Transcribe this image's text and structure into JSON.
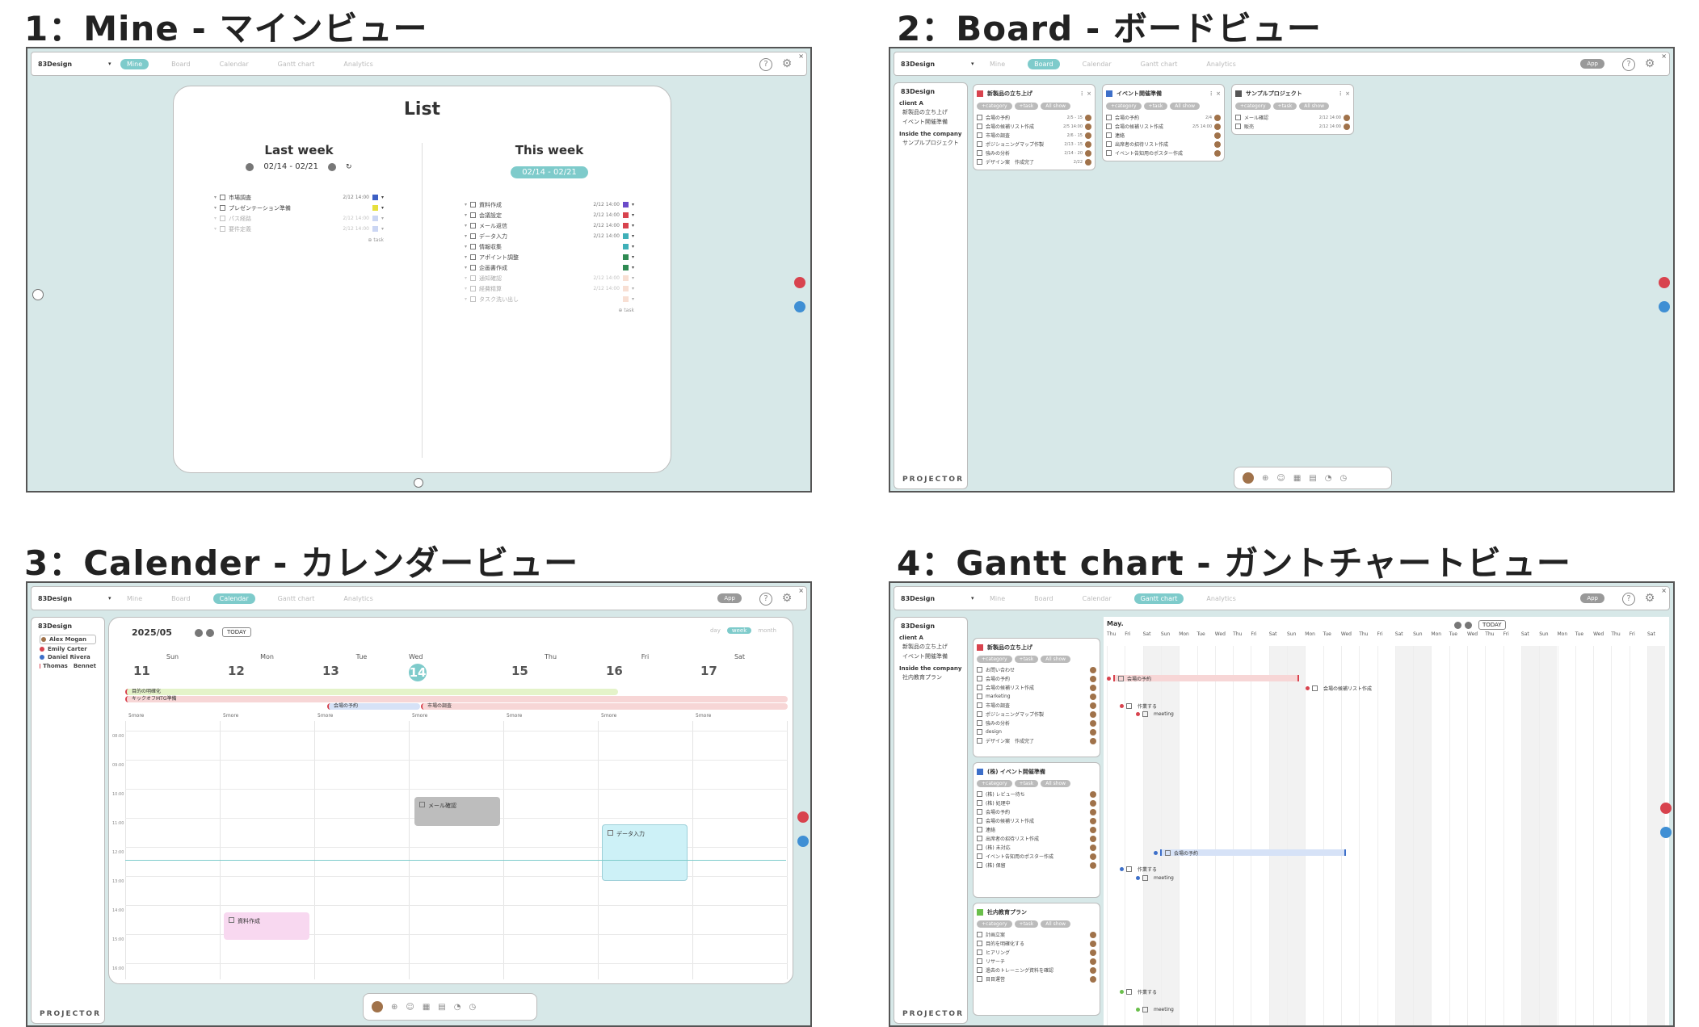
{
  "titles": {
    "mine": "1：Mine - マインビュー",
    "board": "2：Board - ボードビュー",
    "calendar": "3：Calender - カレンダービュー",
    "gantt": "4：Gantt chart - ガントチャートビュー"
  },
  "app": {
    "logo": "83Design",
    "tabs": [
      "Mine",
      "Board",
      "Calendar",
      "Gantt chart",
      "Analytics"
    ],
    "app_button": "App",
    "help_icon": "?",
    "footer_logo": "PROJECTOR"
  },
  "mine": {
    "list_title": "List",
    "last_week": {
      "title": "Last week",
      "range": "02/14 - 02/21",
      "tasks": [
        {
          "label": "市場調査",
          "date": "2/12 14:00",
          "color": "#3d5fc4",
          "done": false
        },
        {
          "label": "プレゼンテーション準備",
          "date": "",
          "color": "#e6df3c",
          "done": false
        },
        {
          "label": "パス経路",
          "date": "2/12 14:00",
          "color": "#8ea6e6",
          "done": true
        },
        {
          "label": "要件定義",
          "date": "2/12 14:00",
          "color": "#8ea6e6",
          "done": true
        }
      ],
      "add": "task"
    },
    "this_week": {
      "title": "This week",
      "range": "02/14 - 02/21",
      "tasks": [
        {
          "label": "資料作成",
          "date": "2/12 14:00",
          "color": "#6b4bc9",
          "done": false
        },
        {
          "label": "会議設定",
          "date": "2/12 14:00",
          "color": "#d8434e",
          "done": false
        },
        {
          "label": "メール返信",
          "date": "2/12 14:00",
          "color": "#d8434e",
          "done": false
        },
        {
          "label": "データ入力",
          "date": "2/12 14:00",
          "color": "#3fb0b8",
          "done": false
        },
        {
          "label": "情報収集",
          "date": "",
          "color": "#3fb0b8",
          "done": false
        },
        {
          "label": "アポイント調整",
          "date": "",
          "color": "#2f8a52",
          "done": false
        },
        {
          "label": "企画書作成",
          "date": "",
          "color": "#2f8a52",
          "done": false
        },
        {
          "label": "通知確認",
          "date": "2/12 14:00",
          "color": "#f0b9a0",
          "done": true
        },
        {
          "label": "経費精算",
          "date": "2/12 14:00",
          "color": "#f0b9a0",
          "done": true
        },
        {
          "label": "タスク洗い出し",
          "date": "",
          "color": "#f0b9a0",
          "done": true
        }
      ],
      "add": "task"
    },
    "accent": "#7ecbcb"
  },
  "board": {
    "sidebar": {
      "title": "83Design",
      "groups": [
        {
          "name": "client A",
          "items": [
            "新製品の立ち上げ",
            "イベント開催準備"
          ]
        },
        {
          "name": "Inside the company",
          "items": [
            "サンプルプロジェクト"
          ]
        }
      ]
    },
    "columns": [
      {
        "title": "新製品の立ち上げ",
        "color": "#d8434e",
        "tags": [
          "+category",
          "+task",
          "All show"
        ],
        "tasks": [
          {
            "label": "会場の予約",
            "date": "2/5 - 15"
          },
          {
            "label": "会場の候補リスト作成",
            "date": "2/5 14:00"
          },
          {
            "label": "市場の調査",
            "date": "2/6 - 15"
          },
          {
            "label": "ポジショニングマップ作製",
            "date": "2/13 - 15"
          },
          {
            "label": "強みの分析",
            "date": "2/14 - 20"
          },
          {
            "label": "デザイン案　作成完了",
            "date": "2/22"
          }
        ]
      },
      {
        "title": "イベント開催準備",
        "color": "#3d6fc9",
        "tags": [
          "+category",
          "+task",
          "All show"
        ],
        "tasks": [
          {
            "label": "会場の予約",
            "date": "2/4"
          },
          {
            "label": "会場の候補リスト作成",
            "date": "2/5 14:00"
          },
          {
            "label": "連絡",
            "date": ""
          },
          {
            "label": "出席者の招待リスト作成",
            "date": ""
          },
          {
            "label": "イベント告知用のポスター作成",
            "date": ""
          }
        ]
      },
      {
        "title": "サンプルプロジェクト",
        "color": "#555555",
        "tags": [
          "+category",
          "+task",
          "All show"
        ],
        "tasks": [
          {
            "label": "メール確認",
            "date": "2/12 14:00"
          },
          {
            "label": "販売",
            "date": "2/12 14:00"
          }
        ]
      }
    ]
  },
  "calendar": {
    "sidebar": {
      "title": "83Design",
      "members": [
        "Alex Mogan",
        "Emily Carter",
        "Daniel Rivera",
        "Thomas　Bennet"
      ]
    },
    "month": "2025/05",
    "today": "TODAY",
    "views": [
      "day",
      "week",
      "month"
    ],
    "days": [
      {
        "name": "Sun",
        "num": "11"
      },
      {
        "name": "Mon",
        "num": "12"
      },
      {
        "name": "Tue",
        "num": "13"
      },
      {
        "name": "Wed",
        "num": "14"
      },
      {
        "name": "Thu",
        "num": "15"
      },
      {
        "name": "Fri",
        "num": "16"
      },
      {
        "name": "Sat",
        "num": "17"
      }
    ],
    "allday": [
      {
        "label": "目的の明確化",
        "color": "#e4f3c9"
      },
      {
        "label": "キックオフMTG準備",
        "color": "#f7d6d6"
      },
      {
        "label": "会場の予約",
        "color": "#d6e2f7"
      },
      {
        "label": "市場の調査",
        "color": "#f7d6d6"
      }
    ],
    "more": "5more",
    "hours": [
      "08:00",
      "09:00",
      "10:00",
      "11:00",
      "12:00",
      "13:00",
      "14:00",
      "15:00",
      "16:00"
    ],
    "events": [
      {
        "label": "メール確認",
        "color": "#bdbdbd"
      },
      {
        "label": "データ入力",
        "color": "#cdf1f7"
      },
      {
        "label": "資料作成",
        "color": "#f8d8f0"
      }
    ]
  },
  "gantt": {
    "sidebar": {
      "title": "83Design",
      "groups": [
        {
          "name": "client A",
          "items": [
            "新製品の立ち上げ",
            "イベント開催準備"
          ]
        },
        {
          "name": "Inside the company",
          "items": [
            "社内教育プラン"
          ]
        }
      ]
    },
    "month": "May.",
    "today": "TODAY",
    "weekdays": [
      "Thu",
      "Fri",
      "Sat",
      "Sun",
      "Mon",
      "Tue",
      "Wed",
      "Thu",
      "Fri",
      "Sat",
      "Sun",
      "Mon",
      "Tue",
      "Wed",
      "Thu",
      "Fri",
      "Sat",
      "Sun",
      "Mon",
      "Tue",
      "Wed",
      "Thu",
      "Fri",
      "Sat",
      "Sun",
      "Mon",
      "Tue",
      "Wed",
      "Thu",
      "Fri",
      "Sat"
    ],
    "projects": [
      {
        "title": "新製品の立ち上げ",
        "color": "#d8434e",
        "rows": [
          "お問い合わせ",
          "会場の予約",
          "会場の候補リスト作成",
          "marketing",
          "市場の調査",
          "ポジショニングマップ作製",
          "強みの分析",
          "design",
          "デザイン案　作成完了"
        ]
      },
      {
        "title": "(株) イベント開催準備",
        "color": "#3d6fc9",
        "rows": [
          "(株) レビュー待ち",
          "(株) 処理中",
          "会場の予約",
          "会場の候補リスト作成",
          "連絡",
          "出席者の招待リスト作成",
          "(株) 未対応",
          "イベント告知用のポスター作成",
          "(株) 保留"
        ]
      },
      {
        "title": "社内教育プラン",
        "color": "#6abf4b",
        "rows": [
          "計画立案",
          "目的を明確化する",
          "ヒアリング",
          "リサーチ",
          "過去のトレーニング資料を確認",
          "目目運営"
        ]
      }
    ],
    "bars": [
      {
        "label": "会場の予約",
        "color": "#f7d6d6"
      },
      {
        "label": "会場の候補リスト作成",
        "color": ""
      },
      {
        "label": "作業する",
        "color": ""
      },
      {
        "label": "meeting",
        "color": ""
      },
      {
        "label": "会場の予約",
        "color": "#d6e2f7"
      },
      {
        "label": "作業する",
        "color": ""
      },
      {
        "label": "meeting",
        "color": ""
      },
      {
        "label": "作業する",
        "color": ""
      },
      {
        "label": "meeting",
        "color": ""
      }
    ]
  },
  "colors": {
    "bg": "#d7e8e8",
    "red": "#d8434e",
    "blue": "#3f8fd4",
    "accent": "#7ecbcb"
  }
}
